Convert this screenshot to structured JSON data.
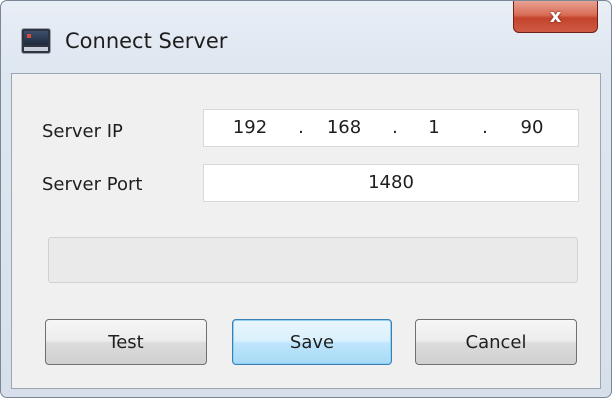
{
  "window": {
    "title": "Connect Server",
    "close_glyph": "x",
    "icon": "monitor-app-icon"
  },
  "form": {
    "server_ip_label": "Server IP",
    "server_ip": {
      "octet1": "192",
      "octet2": "168",
      "octet3": "1",
      "octet4": "90",
      "separator": "."
    },
    "server_port_label": "Server Port",
    "server_port_value": "1480",
    "status_text": ""
  },
  "buttons": {
    "test_label": "Test",
    "save_label": "Save",
    "cancel_label": "Cancel"
  },
  "colors": {
    "close_button": "#c3432c",
    "default_button_border": "#3c7fb1"
  }
}
